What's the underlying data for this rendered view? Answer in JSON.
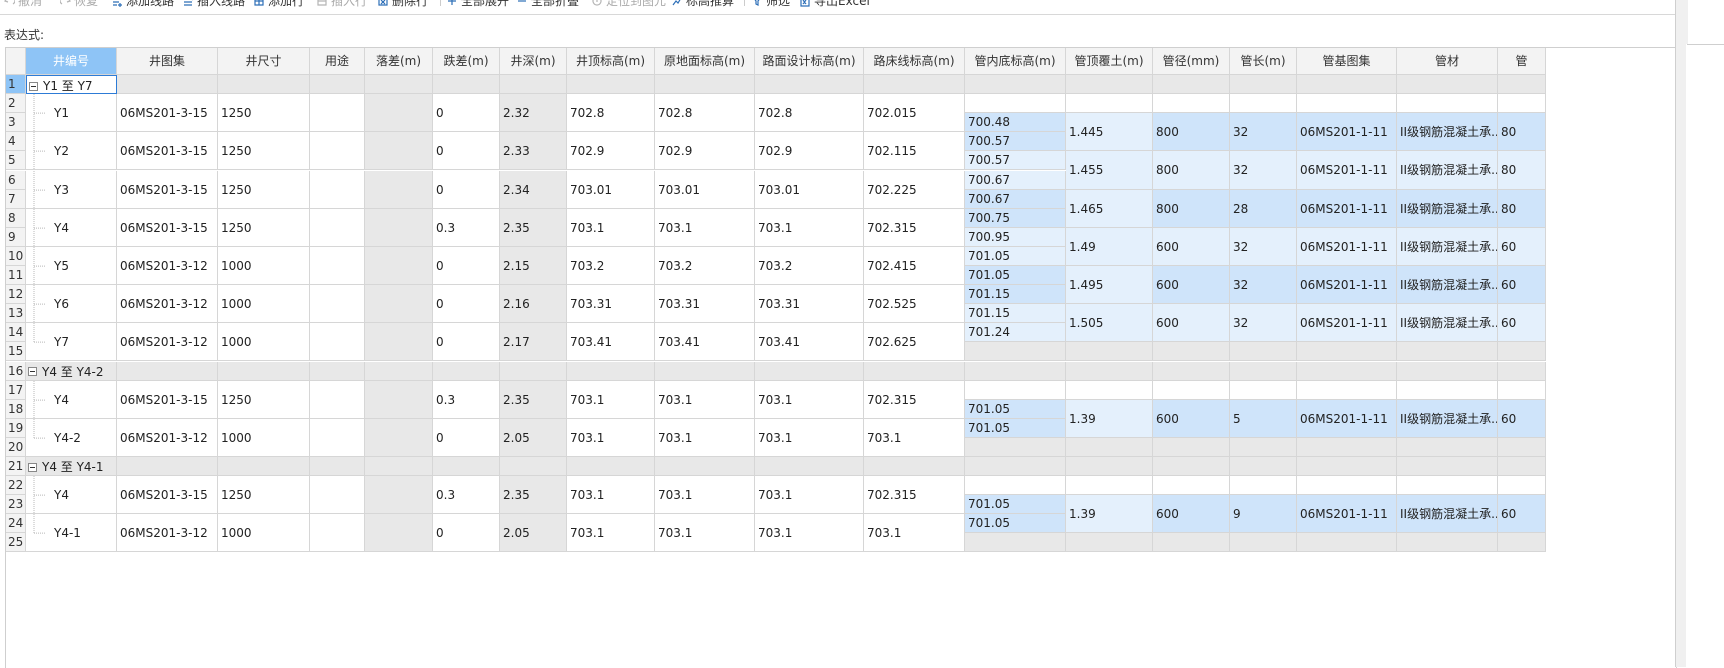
{
  "toolbar": {
    "items": [
      {
        "label": "撤消",
        "icon": "undo-icon",
        "disabled": true
      },
      {
        "label": "恢复",
        "icon": "redo-icon",
        "disabled": true
      },
      {
        "label": "添加线路",
        "icon": "add-line-icon",
        "disabled": false
      },
      {
        "label": "插入线路",
        "icon": "insert-line-icon",
        "disabled": false
      },
      {
        "label": "添加行",
        "icon": "add-row-icon",
        "disabled": false
      },
      {
        "label": "插入行",
        "icon": "insert-row-icon",
        "disabled": true
      },
      {
        "label": "删除行",
        "icon": "delete-row-icon",
        "disabled": false
      },
      {
        "label": "全部展开",
        "icon": "expand-all-icon",
        "disabled": false
      },
      {
        "label": "全部折叠",
        "icon": "collapse-all-icon",
        "disabled": false
      },
      {
        "label": "定位到图元",
        "icon": "locate-icon",
        "disabled": true
      },
      {
        "label": "标高推算",
        "icon": "elevation-calc-icon",
        "disabled": false
      },
      {
        "label": "筛选",
        "icon": "filter-icon",
        "disabled": false
      },
      {
        "label": "导出Excel",
        "icon": "export-excel-icon",
        "disabled": false
      }
    ]
  },
  "expression_label": "表达式:",
  "columns": [
    "井编号",
    "井图集",
    "井尺寸",
    "用途",
    "落差(m)",
    "跌差(m)",
    "井深(m)",
    "井顶标高(m)",
    "原地面标高(m)",
    "路面设计标高(m)",
    "路床线标高(m)",
    "管内底标高(m)",
    "管顶覆土(m)",
    "管径(mm)",
    "管长(m)",
    "管基图集",
    "管材",
    "管"
  ],
  "row_numbers": [
    "1",
    "2",
    "3",
    "4",
    "5",
    "6",
    "7",
    "8",
    "9",
    "10",
    "11",
    "12",
    "13",
    "14",
    "15",
    "16",
    "17",
    "18",
    "19",
    "20",
    "21",
    "22",
    "23",
    "24",
    "25"
  ],
  "groups": [
    {
      "label": "Y1 至 Y7",
      "wells": [
        {
          "id": "Y1",
          "atlas": "06MS201-3-15",
          "size": "1250",
          "use": "",
          "drop": "",
          "jump": "0",
          "depth": "2.32",
          "top": "702.8",
          "ground": "702.8",
          "road": "702.8",
          "bed": "702.015"
        },
        {
          "id": "Y2",
          "atlas": "06MS201-3-15",
          "size": "1250",
          "use": "",
          "drop": "",
          "jump": "0",
          "depth": "2.33",
          "top": "702.9",
          "ground": "702.9",
          "road": "702.9",
          "bed": "702.115"
        },
        {
          "id": "Y3",
          "atlas": "06MS201-3-15",
          "size": "1250",
          "use": "",
          "drop": "",
          "jump": "0",
          "depth": "2.34",
          "top": "703.01",
          "ground": "703.01",
          "road": "703.01",
          "bed": "702.225"
        },
        {
          "id": "Y4",
          "atlas": "06MS201-3-15",
          "size": "1250",
          "use": "",
          "drop": "",
          "jump": "0.3",
          "depth": "2.35",
          "top": "703.1",
          "ground": "703.1",
          "road": "703.1",
          "bed": "702.315"
        },
        {
          "id": "Y5",
          "atlas": "06MS201-3-12",
          "size": "1000",
          "use": "",
          "drop": "",
          "jump": "0",
          "depth": "2.15",
          "top": "703.2",
          "ground": "703.2",
          "road": "703.2",
          "bed": "702.415"
        },
        {
          "id": "Y6",
          "atlas": "06MS201-3-12",
          "size": "1000",
          "use": "",
          "drop": "",
          "jump": "0",
          "depth": "2.16",
          "top": "703.31",
          "ground": "703.31",
          "road": "703.31",
          "bed": "702.525"
        },
        {
          "id": "Y7",
          "atlas": "06MS201-3-12",
          "size": "1000",
          "use": "",
          "drop": "",
          "jump": "0",
          "depth": "2.17",
          "top": "703.41",
          "ground": "703.41",
          "road": "703.41",
          "bed": "702.625"
        }
      ],
      "pipes": [
        {
          "inv_up": "700.48",
          "inv_down": "700.57",
          "cover": "1.445",
          "dia": "800",
          "len": "32",
          "base": "06MS201-1-11",
          "mat": "II级钢筋混凝土承...",
          "extra": "80"
        },
        {
          "inv_up": "700.57",
          "inv_down": "700.67",
          "cover": "1.455",
          "dia": "800",
          "len": "32",
          "base": "06MS201-1-11",
          "mat": "II级钢筋混凝土承...",
          "extra": "80"
        },
        {
          "inv_up": "700.67",
          "inv_down": "700.75",
          "cover": "1.465",
          "dia": "800",
          "len": "28",
          "base": "06MS201-1-11",
          "mat": "II级钢筋混凝土承...",
          "extra": "80"
        },
        {
          "inv_up": "700.95",
          "inv_down": "701.05",
          "cover": "1.49",
          "dia": "600",
          "len": "32",
          "base": "06MS201-1-11",
          "mat": "II级钢筋混凝土承...",
          "extra": "60"
        },
        {
          "inv_up": "701.05",
          "inv_down": "701.15",
          "cover": "1.495",
          "dia": "600",
          "len": "32",
          "base": "06MS201-1-11",
          "mat": "II级钢筋混凝土承...",
          "extra": "60"
        },
        {
          "inv_up": "701.15",
          "inv_down": "701.24",
          "cover": "1.505",
          "dia": "600",
          "len": "32",
          "base": "06MS201-1-11",
          "mat": "II级钢筋混凝土承...",
          "extra": "60"
        }
      ]
    },
    {
      "label": "Y4 至 Y4-2",
      "wells": [
        {
          "id": "Y4",
          "atlas": "06MS201-3-15",
          "size": "1250",
          "use": "",
          "drop": "",
          "jump": "0.3",
          "depth": "2.35",
          "top": "703.1",
          "ground": "703.1",
          "road": "703.1",
          "bed": "702.315"
        },
        {
          "id": "Y4-2",
          "atlas": "06MS201-3-12",
          "size": "1000",
          "use": "",
          "drop": "",
          "jump": "0",
          "depth": "2.05",
          "top": "703.1",
          "ground": "703.1",
          "road": "703.1",
          "bed": "703.1"
        }
      ],
      "pipes": [
        {
          "inv_up": "701.05",
          "inv_down": "701.05",
          "cover": "1.39",
          "dia": "600",
          "len": "5",
          "base": "06MS201-1-11",
          "mat": "II级钢筋混凝土承...",
          "extra": "60"
        }
      ]
    },
    {
      "label": "Y4 至 Y4-1",
      "wells": [
        {
          "id": "Y4",
          "atlas": "06MS201-3-15",
          "size": "1250",
          "use": "",
          "drop": "",
          "jump": "0.3",
          "depth": "2.35",
          "top": "703.1",
          "ground": "703.1",
          "road": "703.1",
          "bed": "702.315"
        },
        {
          "id": "Y4-1",
          "atlas": "06MS201-3-12",
          "size": "1000",
          "use": "",
          "drop": "",
          "jump": "0",
          "depth": "2.05",
          "top": "703.1",
          "ground": "703.1",
          "road": "703.1",
          "bed": "703.1"
        }
      ],
      "pipes": [
        {
          "inv_up": "701.05",
          "inv_down": "701.05",
          "cover": "1.39",
          "dia": "600",
          "len": "9",
          "base": "06MS201-1-11",
          "mat": "II级钢筋混凝土承...",
          "extra": "60"
        }
      ]
    }
  ],
  "colors": {
    "header_selected": "#8ec4f6",
    "pipe_cell": "#cfe4fa",
    "pipe_cell_alt": "#e4f0fc",
    "group_row": "#e8e8e8",
    "selection_border": "#2d7bd6"
  }
}
